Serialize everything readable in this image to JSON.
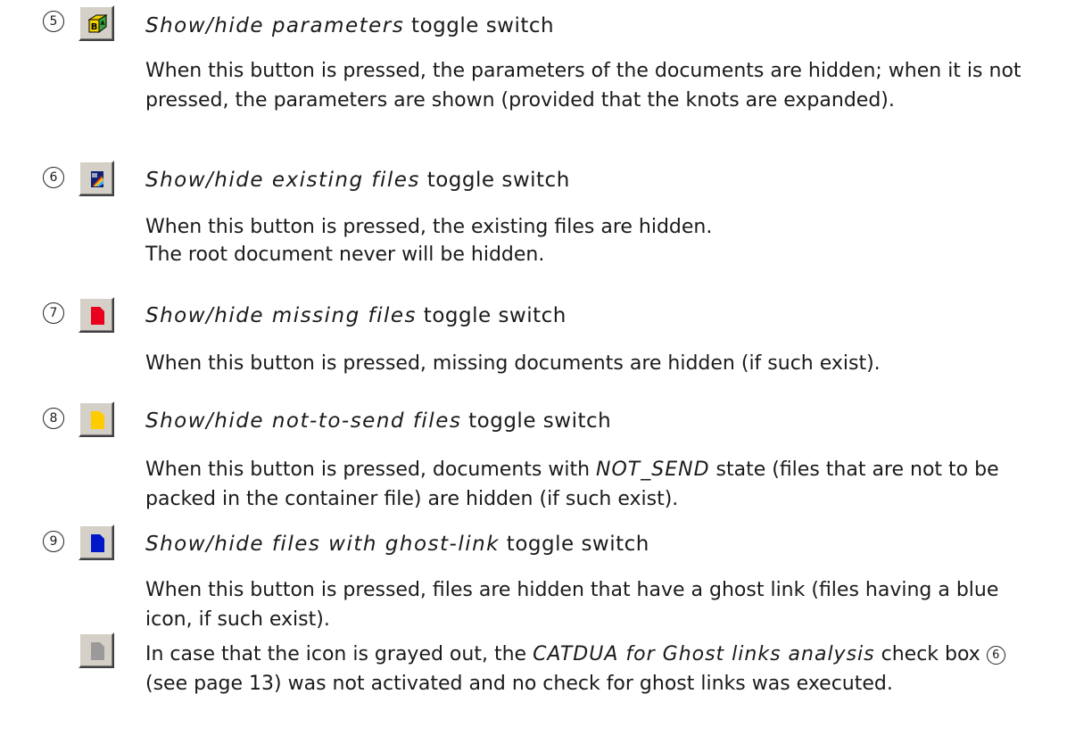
{
  "items": [
    {
      "number": "5",
      "icon": "show-hide-parameters-icon",
      "title_italic": "Show/hide parameters",
      "title_rest": " toggle switch",
      "paragraphs": [
        "When this button is pressed, the parameters of the documents are hidden; when it is not pressed, the parameters are shown (provided that the knots are expanded)."
      ]
    },
    {
      "number": "6",
      "icon": "show-hide-existing-files-icon",
      "title_italic": "Show/hide existing files",
      "title_rest": " toggle switch",
      "paragraphs": [
        "When this button is pressed, the existing files are hidden.",
        "The root document never will be hidden."
      ]
    },
    {
      "number": "7",
      "icon": "show-hide-missing-files-icon",
      "title_italic": "Show/hide missing files",
      "title_rest": " toggle switch",
      "paragraphs": [
        "When this button is pressed, missing documents are hidden (if such exist)."
      ]
    },
    {
      "number": "8",
      "icon": "show-hide-not-to-send-files-icon",
      "title_italic": "Show/hide not-to-send files",
      "title_rest": " toggle switch",
      "paragraphs": [
        "When this button is pressed, documents with ",
        "NOT_SEND",
        " state (files that are not to be packed in the container file) are hidden (if such exist)."
      ]
    },
    {
      "number": "9",
      "icon": "show-hide-ghost-link-files-icon",
      "title_italic": "Show/hide files with ghost-link",
      "title_rest": " toggle switch",
      "paragraphs": [
        "When this button is pressed, files are hidden that have a ghost link (files having a blue icon, if such exist)."
      ]
    }
  ],
  "note": {
    "icon": "grayed-ghost-link-icon",
    "text_before": "In case that the icon is grayed out, the ",
    "text_italic": "CATDUA for Ghost links analysis",
    "text_middle": " check box ",
    "ref_number": "6",
    "text_after": " (see page 13) was not activated and no check for ghost links was executed."
  },
  "colors": {
    "missing": "#e8001c",
    "not_to_send": "#ffcc00",
    "ghost_link": "#0018c8",
    "grayed": "#9a9a9a"
  }
}
